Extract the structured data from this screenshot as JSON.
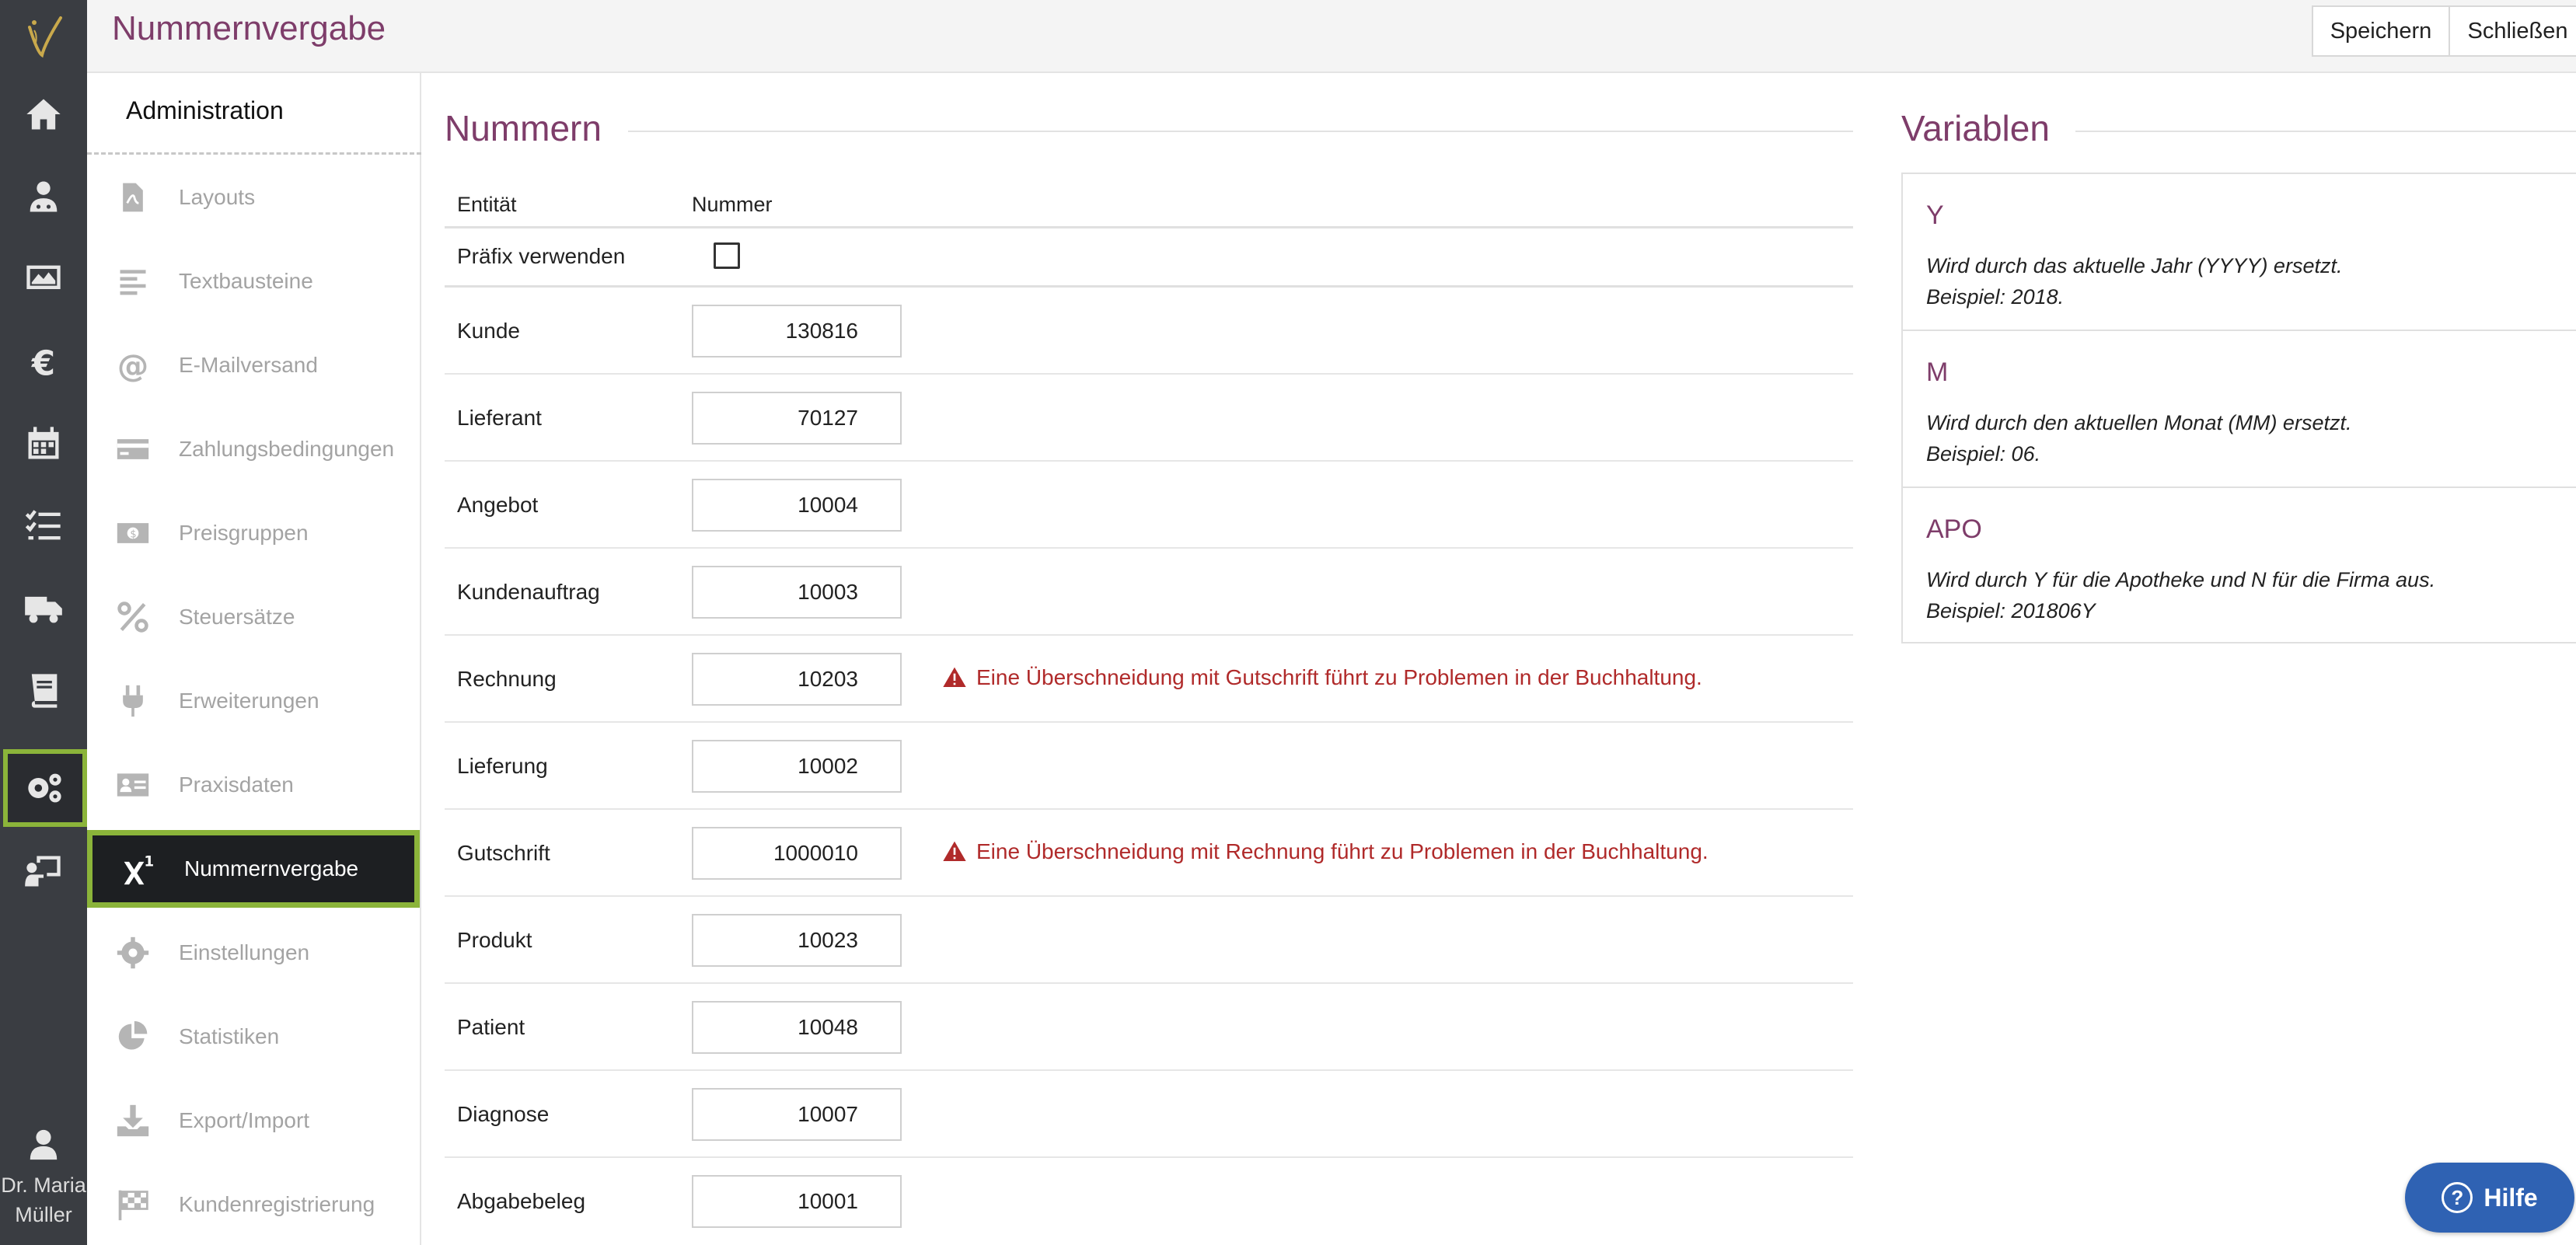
{
  "header": {
    "title": "Nummernvergabe",
    "save_label": "Speichern",
    "close_label": "Schließen"
  },
  "rail": {
    "items": [
      {
        "name": "home-icon"
      },
      {
        "name": "doctor-icon"
      },
      {
        "name": "monitor-chart-icon"
      },
      {
        "name": "euro-icon"
      },
      {
        "name": "calendar-icon"
      },
      {
        "name": "checklist-icon"
      },
      {
        "name": "truck-icon"
      },
      {
        "name": "book-icon"
      },
      {
        "name": "gears-icon",
        "active": true
      },
      {
        "name": "presentation-icon"
      }
    ],
    "user_line1": "Dr. Maria",
    "user_line2": "Müller"
  },
  "sidebar": {
    "title": "Administration",
    "items": [
      {
        "label": "Layouts",
        "icon": "pdf-file-icon"
      },
      {
        "label": "Textbausteine",
        "icon": "text-align-icon"
      },
      {
        "label": "E-Mailversand",
        "icon": "at-icon"
      },
      {
        "label": "Zahlungsbedingungen",
        "icon": "credit-card-icon"
      },
      {
        "label": "Preisgruppen",
        "icon": "money-bill-icon"
      },
      {
        "label": "Steuersätze",
        "icon": "percent-icon"
      },
      {
        "label": "Erweiterungen",
        "icon": "plug-icon"
      },
      {
        "label": "Praxisdaten",
        "icon": "id-card-icon"
      },
      {
        "label": "Nummernvergabe",
        "icon": "superscript-icon",
        "active": true
      },
      {
        "label": "Einstellungen",
        "icon": "gear-icon"
      },
      {
        "label": "Statistiken",
        "icon": "pie-chart-icon"
      },
      {
        "label": "Export/Import",
        "icon": "download-icon"
      },
      {
        "label": "Kundenregistrierung",
        "icon": "flag-checkered-icon"
      }
    ]
  },
  "numbers": {
    "title": "Nummern",
    "col_entity": "Entität",
    "col_number": "Nummer",
    "prefix_label": "Präfix verwenden",
    "prefix_checked": false,
    "rows": [
      {
        "label": "Kunde",
        "value": "130816",
        "warning": ""
      },
      {
        "label": "Lieferant",
        "value": "70127",
        "warning": ""
      },
      {
        "label": "Angebot",
        "value": "10004",
        "warning": ""
      },
      {
        "label": "Kundenauftrag",
        "value": "10003",
        "warning": ""
      },
      {
        "label": "Rechnung",
        "value": "10203",
        "warning": "Eine Überschneidung mit Gutschrift führt zu Problemen in der Buchhaltung."
      },
      {
        "label": "Lieferung",
        "value": "10002",
        "warning": ""
      },
      {
        "label": "Gutschrift",
        "value": "1000010",
        "warning": "Eine Überschneidung mit Rechnung führt zu Problemen in der Buchhaltung."
      },
      {
        "label": "Produkt",
        "value": "10023",
        "warning": ""
      },
      {
        "label": "Patient",
        "value": "10048",
        "warning": ""
      },
      {
        "label": "Diagnose",
        "value": "10007",
        "warning": ""
      },
      {
        "label": "Abgabebeleg",
        "value": "10001",
        "warning": ""
      }
    ]
  },
  "variables": {
    "title": "Variablen",
    "items": [
      {
        "name": "Y",
        "desc": "Wird durch das aktuelle Jahr (YYYY) ersetzt.",
        "example": "Beispiel: 2018."
      },
      {
        "name": "M",
        "desc": "Wird durch den aktuellen Monat (MM) ersetzt.",
        "example": "Beispiel: 06."
      },
      {
        "name": "APO",
        "desc": "Wird durch Y für die Apotheke und N für die Firma aus.",
        "example": "Beispiel: 201806Y"
      }
    ]
  },
  "help": {
    "label": "Hilfe"
  },
  "colors": {
    "accent_purple": "#7e3d6a",
    "active_green": "#8bb43a",
    "rail_bg": "#3a3d42",
    "warning_red": "#b02a2a",
    "help_blue": "#2f62b3"
  }
}
